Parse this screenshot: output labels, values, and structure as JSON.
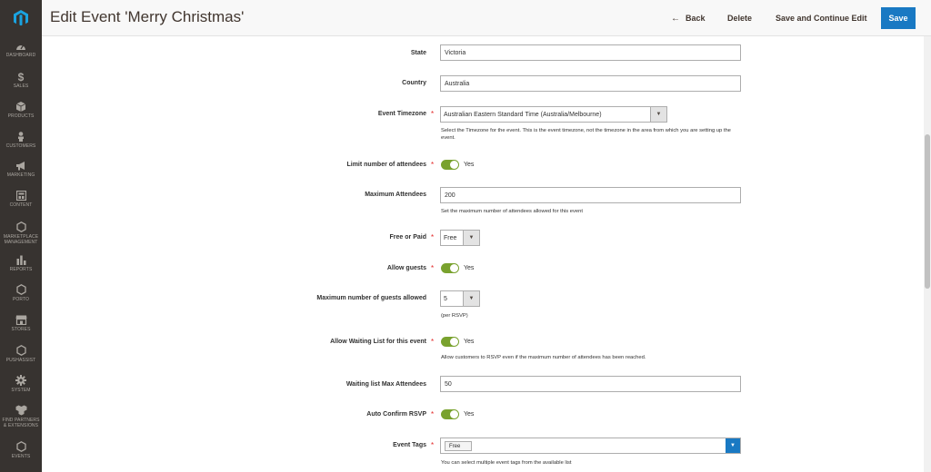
{
  "header": {
    "title": "Edit Event 'Merry Christmas'",
    "back_label": "Back",
    "delete_label": "Delete",
    "save_continue_label": "Save and Continue Edit",
    "save_label": "Save"
  },
  "sidebar": {
    "items": [
      {
        "label": "DASHBOARD",
        "icon": "dashboard-icon"
      },
      {
        "label": "SALES",
        "icon": "dollar-icon"
      },
      {
        "label": "PRODUCTS",
        "icon": "cube-icon"
      },
      {
        "label": "CUSTOMERS",
        "icon": "person-icon"
      },
      {
        "label": "MARKETING",
        "icon": "megaphone-icon"
      },
      {
        "label": "CONTENT",
        "icon": "layout-icon"
      },
      {
        "label": "MARKETPLACE MANAGEMENT",
        "icon": "hexagon-icon"
      },
      {
        "label": "REPORTS",
        "icon": "bar-chart-icon"
      },
      {
        "label": "PORTO",
        "icon": "hexagon-icon"
      },
      {
        "label": "STORES",
        "icon": "store-icon"
      },
      {
        "label": "PUSHASSIST",
        "icon": "hexagon-icon"
      },
      {
        "label": "SYSTEM",
        "icon": "gear-icon"
      },
      {
        "label": "FIND PARTNERS & EXTENSIONS",
        "icon": "boxes-icon"
      },
      {
        "label": "EVENTS",
        "icon": "hexagon-icon"
      }
    ]
  },
  "form": {
    "state": {
      "label": "State",
      "value": "Victoria"
    },
    "country": {
      "label": "Country",
      "value": "Australia"
    },
    "timezone": {
      "label": "Event Timezone",
      "value": "Australian Eastern Standard Time (Australia/Melbourne)",
      "note": "Select the Timezone for the event. This is the event timezone, not the timezone in the area from which you are setting up the event."
    },
    "limit_attendees": {
      "label": "Limit number of attendees",
      "value": "Yes"
    },
    "max_attendees": {
      "label": "Maximum Attendees",
      "value": "200",
      "note": "Set the maximum number of attendees allowed for this event"
    },
    "free_paid": {
      "label": "Free or Paid",
      "value": "Free"
    },
    "allow_guests": {
      "label": "Allow guests",
      "value": "Yes"
    },
    "max_guests": {
      "label": "Maximum number of guests allowed",
      "value": "5",
      "note": "(per RSVP)"
    },
    "waiting_list": {
      "label": "Allow Waiting List for this event",
      "value": "Yes",
      "note": "Allow customers to RSVP even if the maximum number of attendees has been reached."
    },
    "waiting_max": {
      "label": "Waiting list Max Attendees",
      "value": "50"
    },
    "auto_confirm": {
      "label": "Auto Confirm RSVP",
      "value": "Yes"
    },
    "event_tags": {
      "label": "Event Tags",
      "tag": "Free",
      "note": "You can select multiple event tags from the available list"
    }
  },
  "colors": {
    "sidebar_bg": "#373330",
    "save_button": "#1979c3",
    "toggle_on": "#79a22e",
    "required_star": "#e22626"
  }
}
